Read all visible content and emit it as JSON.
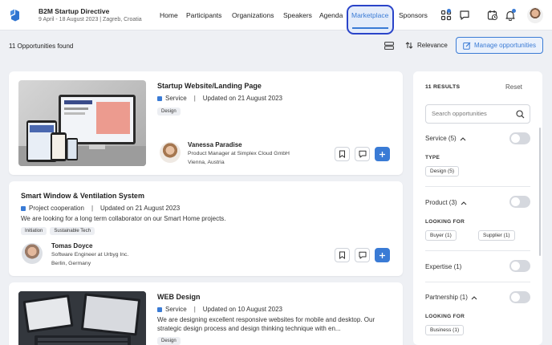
{
  "header": {
    "title": "B2M Startup Directive",
    "subtitle": "9 April - 18 August 2023 | Zagreb, Croatia",
    "nav": [
      "Home",
      "Participants",
      "Organizations",
      "Speakers",
      "Agenda",
      "Marketplace",
      "Sponsors"
    ],
    "active_nav": "Marketplace",
    "icons": [
      "apps-grid-icon",
      "chat-icon",
      "calendar-clock-icon",
      "bell-icon"
    ]
  },
  "toolbar": {
    "count_text": "11 Opportunities found",
    "sort_label": "Relevance",
    "manage_label": "Manage opportunities"
  },
  "cards": [
    {
      "title": "Startup Website/Landing Page",
      "type": "Service",
      "updated": "Updated on 21 August 2023",
      "tags": [
        "Design"
      ],
      "person": {
        "name": "Vanessa Paradise",
        "role": "Product Manager at Simplex Cloud GmbH",
        "location": "Vienna, Austria"
      }
    },
    {
      "title": "Smart Window & Ventilation System",
      "type": "Project cooperation",
      "updated": "Updated on 21 August 2023",
      "description": "We are looking for a long term collaborator on our Smart Home projects.",
      "tags": [
        "Initiation",
        "Sustainable Tech"
      ],
      "person": {
        "name": "Tomas Doyce",
        "role": "Software Engineer at Urbyg Inc.",
        "location": "Berlin, Germany"
      }
    },
    {
      "title": "WEB Design",
      "type": "Service",
      "updated": "Updated on 10 August 2023",
      "description_line1": "We are designing excellent responsive websites for mobile and desktop. Our",
      "description_line2": "strategic design process and design thinking technique with en...",
      "tags": [
        "Design"
      ]
    }
  ],
  "filters": {
    "results_label": "11 RESULTS",
    "reset_label": "Reset",
    "search_placeholder": "Search opportunities",
    "groups": [
      {
        "label": "Service (5)",
        "sublabel": "TYPE",
        "chips": [
          "Design (5)"
        ]
      },
      {
        "label": "Product (3)",
        "sublabel": "LOOKING FOR",
        "chips": [
          "Buyer (1)",
          "Supplier (1)"
        ]
      },
      {
        "label": "Expertise (1)"
      },
      {
        "label": "Partnership (1)",
        "sublabel": "LOOKING FOR",
        "chips": [
          "Business (1)"
        ]
      }
    ]
  },
  "colors": {
    "accent": "#3a7bd5",
    "highlight_border": "#2a44c9"
  }
}
